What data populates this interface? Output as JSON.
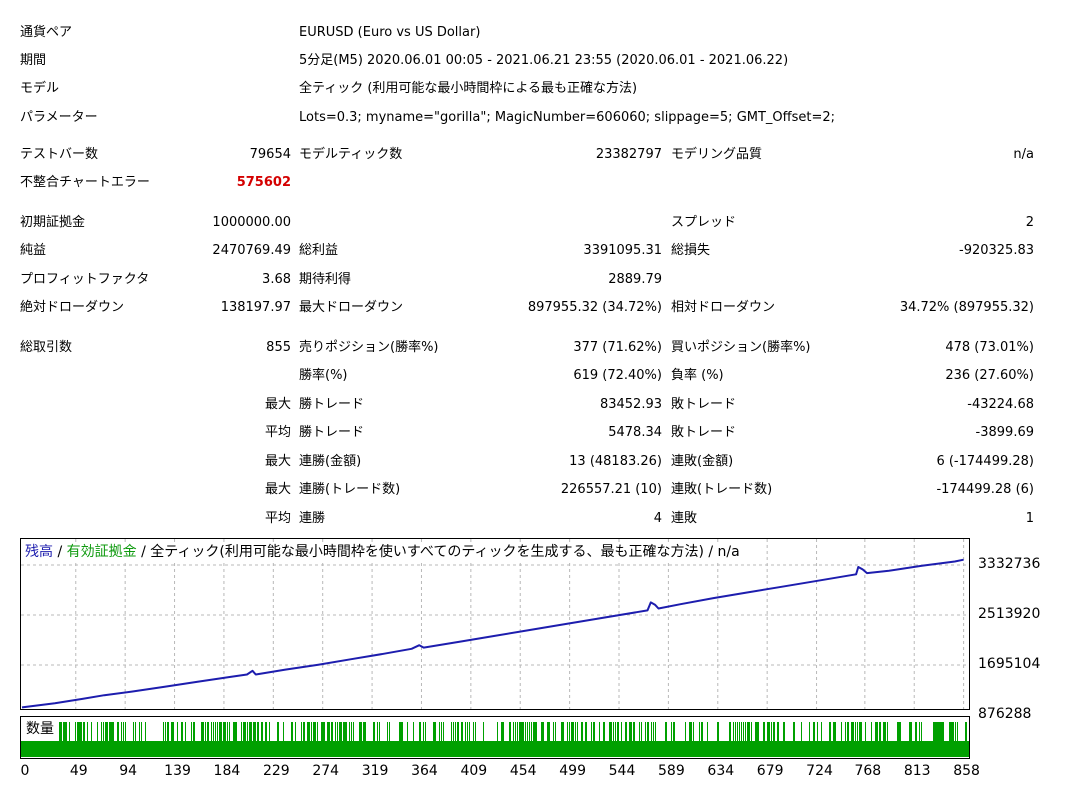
{
  "info": {
    "symbol_label": "通貨ペア",
    "symbol_value": "EURUSD (Euro vs US Dollar)",
    "period_label": "期間",
    "period_value": "5分足(M5) 2020.06.01 00:05 - 2021.06.21 23:55 (2020.06.01 - 2021.06.22)",
    "model_label": "モデル",
    "model_value": "全ティック (利用可能な最小時間枠による最も正確な方法)",
    "params_label": "パラメーター",
    "params_value": "Lots=0.3; myname=\"gorilla\"; MagicNumber=606060; slippage=5; GMT_Offset=2;"
  },
  "bars": {
    "test_bars_label": "テストバー数",
    "test_bars_value": "79654",
    "model_ticks_label": "モデルティック数",
    "model_ticks_value": "23382797",
    "quality_label": "モデリング品質",
    "quality_value": "n/a",
    "mismatch_label": "不整合チャートエラー",
    "mismatch_value": "575602"
  },
  "money": {
    "initial_deposit_label": "初期証拠金",
    "initial_deposit_value": "1000000.00",
    "spread_label": "スプレッド",
    "spread_value": "2",
    "net_profit_label": "純益",
    "net_profit_value": "2470769.49",
    "gross_profit_label": "総利益",
    "gross_profit_value": "3391095.31",
    "gross_loss_label": "総損失",
    "gross_loss_value": "-920325.83",
    "profit_factor_label": "プロフィットファクタ",
    "profit_factor_value": "3.68",
    "expected_payoff_label": "期待利得",
    "expected_payoff_value": "2889.79",
    "abs_dd_label": "絶対ドローダウン",
    "abs_dd_value": "138197.97",
    "max_dd_label": "最大ドローダウン",
    "max_dd_value": "897955.32 (34.72%)",
    "rel_dd_label": "相対ドローダウン",
    "rel_dd_value": "34.72% (897955.32)"
  },
  "trades": {
    "total_label": "総取引数",
    "total_value": "855",
    "short_label": "売りポジション(勝率%)",
    "short_value": "377 (71.62%)",
    "long_label": "買いポジション(勝率%)",
    "long_value": "478 (73.01%)",
    "win_rate_label": "勝率(%)",
    "win_rate_value": "619 (72.40%)",
    "loss_rate_label": "負率 (%)",
    "loss_rate_value": "236 (27.60%)",
    "max_label_1": "最大",
    "largest_win_label": "勝トレード",
    "largest_win_value": "83452.93",
    "largest_loss_label": "敗トレード",
    "largest_loss_value": "-43224.68",
    "avg_label_1": "平均",
    "avg_win_label": "勝トレード",
    "avg_win_value": "5478.34",
    "avg_loss_label": "敗トレード",
    "avg_loss_value": "-3899.69",
    "max_label_2": "最大",
    "cons_wins_money_label": "連勝(金額)",
    "cons_wins_money_value": "13 (48183.26)",
    "cons_losses_money_label": "連敗(金額)",
    "cons_losses_money_value": "6 (-174499.28)",
    "max_label_3": "最大",
    "cons_profit_count_label": "連勝(トレード数)",
    "cons_profit_count_value": "226557.21 (10)",
    "cons_loss_count_label": "連敗(トレード数)",
    "cons_loss_count_value": "-174499.28 (6)",
    "avg_label_2": "平均",
    "avg_cons_wins_label": "連勝",
    "avg_cons_wins_value": "4",
    "avg_cons_losses_label": "連敗",
    "avg_cons_losses_value": "1"
  },
  "chart_legend": {
    "balance": "残高",
    "sep1": " / ",
    "equity": "有効証拠金",
    "rest": " / 全ティック(利用可能な最小時間枠を使いすべてのティックを生成する、最も正確な方法) / n/a"
  },
  "volume_label": "数量",
  "colors": {
    "balance_line": "#1d1dae",
    "equity_legend": "#0f9a0f",
    "volume_bars": "#00a000",
    "grid": "#b8b8b8",
    "error_value": "#d40000"
  },
  "chart_data": {
    "type": "line",
    "title": "",
    "xlabel": "",
    "ylabel": "",
    "x_ticks": [
      "0",
      "49",
      "94",
      "139",
      "184",
      "229",
      "274",
      "319",
      "364",
      "409",
      "454",
      "499",
      "544",
      "589",
      "634",
      "679",
      "724",
      "768",
      "813",
      "858"
    ],
    "y_ticks": [
      "3332736",
      "2513920",
      "1695104",
      "876288"
    ],
    "xlim": [
      0,
      862
    ],
    "ylim": [
      876288,
      3332736
    ],
    "grid": true,
    "series": [
      {
        "name": "残高",
        "x": [
          0,
          30,
          55,
          75,
          100,
          130,
          160,
          190,
          205,
          210,
          213,
          240,
          270,
          300,
          330,
          355,
          362,
          366,
          400,
          430,
          460,
          490,
          520,
          560,
          570,
          573,
          577,
          580,
          600,
          630,
          660,
          690,
          720,
          760,
          762,
          766,
          770,
          790,
          820,
          850,
          858
        ],
        "y": [
          1000000,
          1070000,
          1140000,
          1200000,
          1260000,
          1340000,
          1420000,
          1500000,
          1540000,
          1600000,
          1540000,
          1620000,
          1700000,
          1790000,
          1880000,
          1960000,
          2020000,
          1980000,
          2080000,
          2170000,
          2260000,
          2350000,
          2440000,
          2560000,
          2590000,
          2720000,
          2680000,
          2620000,
          2690000,
          2790000,
          2880000,
          2970000,
          3060000,
          3180000,
          3300000,
          3260000,
          3200000,
          3240000,
          3320000,
          3390000,
          3420000
        ]
      }
    ]
  }
}
